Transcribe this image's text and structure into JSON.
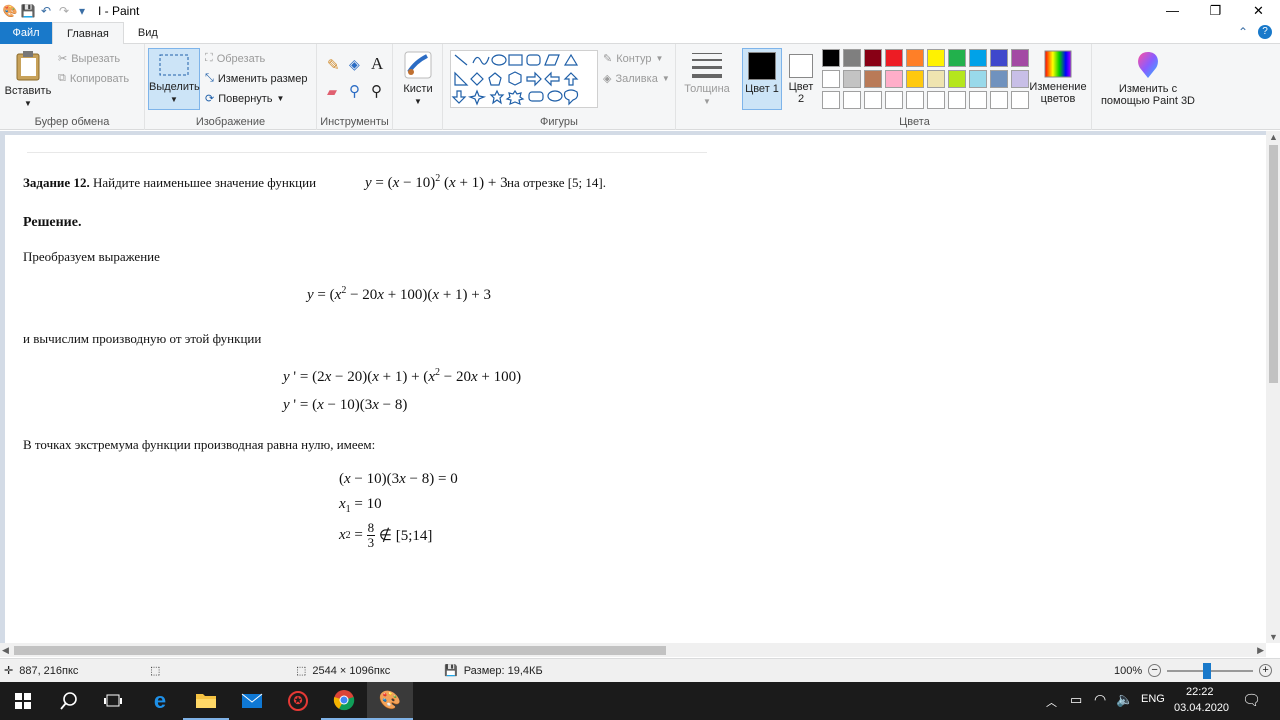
{
  "window": {
    "title": "I - Paint"
  },
  "tabs": {
    "file": "Файл",
    "home": "Главная",
    "view": "Вид"
  },
  "ribbon": {
    "clipboard": {
      "paste": "Вставить",
      "cut": "Вырезать",
      "copy": "Копировать",
      "label": "Буфер обмена"
    },
    "image": {
      "select": "Выделить",
      "crop": "Обрезать",
      "resize": "Изменить размер",
      "rotate": "Повернуть",
      "label": "Изображение"
    },
    "tools": {
      "label": "Инструменты"
    },
    "brushes": {
      "label": "Кисти"
    },
    "shapes": {
      "outline": "Контур",
      "fill": "Заливка",
      "label": "Фигуры"
    },
    "thickness": {
      "label": "Толщина"
    },
    "colors": {
      "color1": "Цвет 1",
      "color2": "Цвет 2",
      "edit": "Изменение цветов",
      "label": "Цвета",
      "palette": [
        "#000000",
        "#7f7f7f",
        "#880015",
        "#ed1c24",
        "#ff7f27",
        "#fff200",
        "#22b14c",
        "#00a2e8",
        "#3f48cc",
        "#a349a4",
        "#ffffff",
        "#c3c3c3",
        "#b97a57",
        "#ffaec9",
        "#ffc90e",
        "#efe4b0",
        "#b5e61d",
        "#99d9ea",
        "#7092be",
        "#c8bfe7",
        "#ffffff",
        "#ffffff",
        "#ffffff",
        "#ffffff",
        "#ffffff",
        "#ffffff",
        "#ffffff",
        "#ffffff",
        "#ffffff",
        "#ffffff"
      ]
    },
    "paint3d": {
      "label": "Изменить с помощью Paint 3D"
    }
  },
  "doc": {
    "task_bold": "Задание 12.",
    "task_text": "Найдите наименьшее значение функции",
    "task_interval": "на отрезке [5; 14].",
    "solution": "Решение.",
    "transform": "Преобразуем выражение",
    "derivative": "и вычислим производную от этой функции",
    "extremum": "В точках экстремума функции производная равна нулю, имеем:"
  },
  "status": {
    "cursor": "887, 216пкс",
    "dimensions": "2544 × 1096пкс",
    "size": "Размер: 19,4КБ",
    "zoom": "100%",
    "zoom_level_percent": 100
  },
  "taskbar": {
    "lang": "ENG",
    "time": "22:22",
    "date": "03.04.2020"
  }
}
